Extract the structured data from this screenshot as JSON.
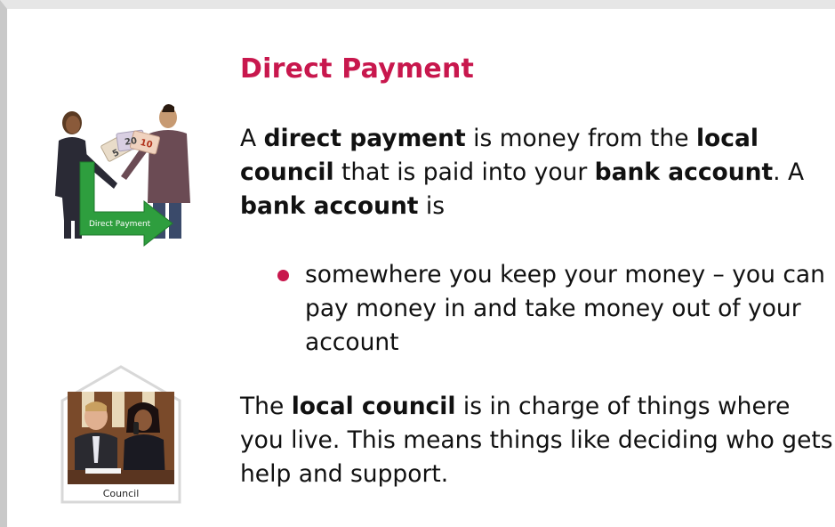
{
  "section": {
    "heading": "Direct Payment"
  },
  "paragraph1": {
    "t1": "A ",
    "b1": "direct payment",
    "t2": " is money from the ",
    "b2": "local council",
    "t3": " that is paid into your ",
    "b3": "bank account",
    "t4": ". A ",
    "b4": "bank account",
    "t5": " is"
  },
  "bullets": [
    "somewhere you keep your money – you can pay money in and take money out of your account"
  ],
  "paragraph2": {
    "t1": "The ",
    "b1": "local council",
    "t2": " is in charge of things where you live. This means things like deciding who gets help and support."
  },
  "illustrations": {
    "payment_label": "Direct Payment",
    "council_label": "Council",
    "note_5": "5",
    "note_20": "20",
    "note_10": "10"
  },
  "colors": {
    "heading": "#c8174d",
    "bullet": "#c8174d",
    "arrow": "#2e9e3e"
  }
}
